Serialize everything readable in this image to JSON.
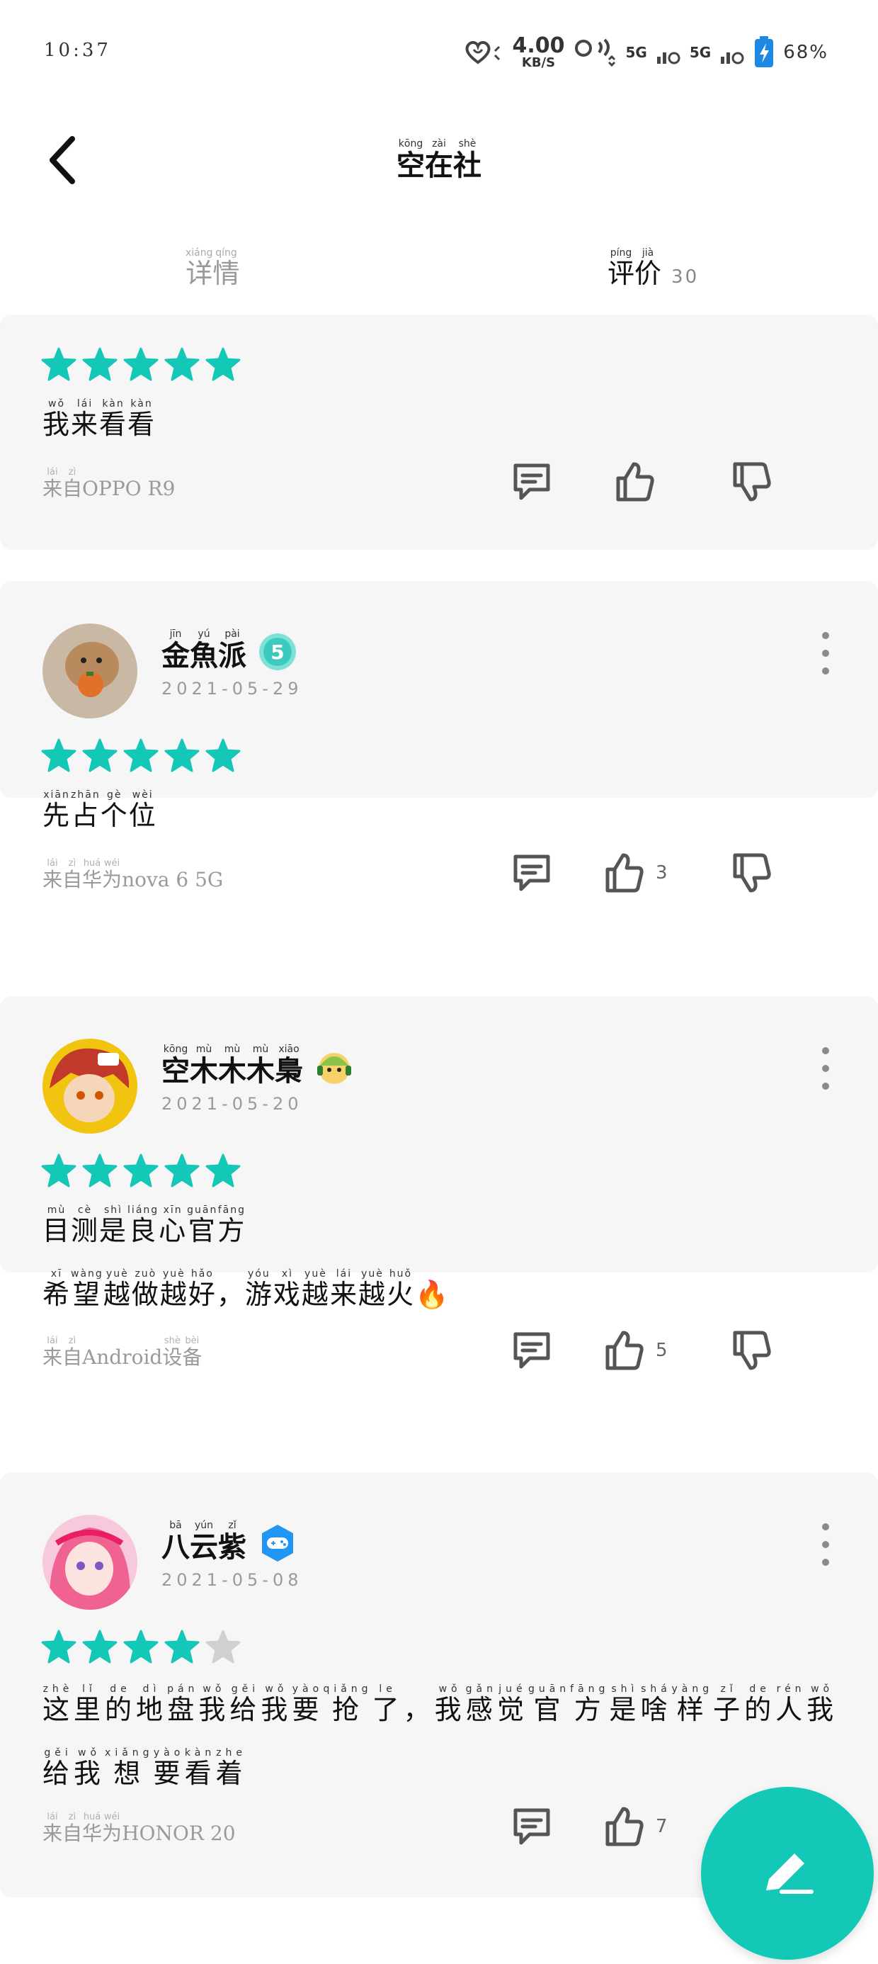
{
  "status_bar": {
    "time": "10:37",
    "speed_value": "4.00",
    "speed_unit": "KB/S",
    "sim1": "5G",
    "sim2": "5G",
    "battery": "68%"
  },
  "header": {
    "title": [
      {
        "char": "空",
        "pinyin": "kōng"
      },
      {
        "char": "在",
        "pinyin": "zài"
      },
      {
        "char": "社",
        "pinyin": "shè"
      }
    ]
  },
  "tabs": {
    "detail": [
      {
        "char": "详",
        "pinyin": "xiáng"
      },
      {
        "char": "情",
        "pinyin": "qíng"
      }
    ],
    "review": [
      {
        "char": "评",
        "pinyin": "píng"
      },
      {
        "char": "价",
        "pinyin": "jià"
      }
    ],
    "review_count": "30"
  },
  "reviews": [
    {
      "rating": 5,
      "content_lines": [
        [
          {
            "char": "我",
            "pinyin": "wǒ"
          },
          {
            "char": "来",
            "pinyin": "lái"
          },
          {
            "char": "看",
            "pinyin": "kàn"
          },
          {
            "char": "看",
            "pinyin": "kàn"
          }
        ]
      ],
      "source": [
        {
          "char": "来",
          "pinyin": "lái"
        },
        {
          "char": "自",
          "pinyin": "zì"
        },
        {
          "text": "OPPO R9"
        }
      ],
      "likes": ""
    },
    {
      "user": [
        {
          "char": "金",
          "pinyin": "jīn"
        },
        {
          "char": "魚",
          "pinyin": "yú"
        },
        {
          "char": "派",
          "pinyin": "pài"
        }
      ],
      "badge": "level-5-badge",
      "date": "2021-05-29",
      "rating": 5,
      "content_lines": [
        [
          {
            "char": "先",
            "pinyin": "xiān"
          },
          {
            "char": "占",
            "pinyin": "zhān"
          },
          {
            "char": "个",
            "pinyin": "gè"
          },
          {
            "char": "位",
            "pinyin": "wèi"
          }
        ]
      ],
      "source": [
        {
          "char": "来",
          "pinyin": "lái"
        },
        {
          "char": "自",
          "pinyin": "zì"
        },
        {
          "char": "华",
          "pinyin": "huá"
        },
        {
          "char": "为",
          "pinyin": "wéi"
        },
        {
          "text": "nova 6 5G"
        }
      ],
      "likes": "3"
    },
    {
      "user": [
        {
          "char": "空",
          "pinyin": "kōng"
        },
        {
          "char": "木",
          "pinyin": "mù"
        },
        {
          "char": "木",
          "pinyin": "mù"
        },
        {
          "char": "木",
          "pinyin": "mù"
        },
        {
          "char": "梟",
          "pinyin": "xiāo"
        }
      ],
      "badge": "gamer-avatar-badge",
      "date": "2021-05-20",
      "rating": 5,
      "content_lines": [
        [
          {
            "char": "目",
            "pinyin": "mù"
          },
          {
            "char": "测",
            "pinyin": "cè"
          },
          {
            "char": "是",
            "pinyin": "shì"
          },
          {
            "char": "良",
            "pinyin": "liáng"
          },
          {
            "char": "心",
            "pinyin": "xīn"
          },
          {
            "char": "官",
            "pinyin": "guān"
          },
          {
            "char": "方",
            "pinyin": "fāng"
          }
        ],
        [
          {
            "char": "希",
            "pinyin": "xī"
          },
          {
            "char": "望",
            "pinyin": "wàng"
          },
          {
            "char": "越",
            "pinyin": "yuè"
          },
          {
            "char": "做",
            "pinyin": "zuò"
          },
          {
            "char": "越",
            "pinyin": "yuè"
          },
          {
            "char": "好",
            "pinyin": "hǎo"
          },
          {
            "text": "，"
          },
          {
            "char": "游",
            "pinyin": "yóu"
          },
          {
            "char": "戏",
            "pinyin": "xì"
          },
          {
            "char": "越",
            "pinyin": "yuè"
          },
          {
            "char": "来",
            "pinyin": "lái"
          },
          {
            "char": "越",
            "pinyin": "yuè"
          },
          {
            "char": "火",
            "pinyin": "huǒ"
          },
          {
            "text": "🔥"
          }
        ]
      ],
      "source": [
        {
          "char": "来",
          "pinyin": "lái"
        },
        {
          "char": "自",
          "pinyin": "zì"
        },
        {
          "text": "Android"
        },
        {
          "char": "设",
          "pinyin": "shè"
        },
        {
          "char": "备",
          "pinyin": "bèi"
        }
      ],
      "likes": "5"
    },
    {
      "user": [
        {
          "char": "八",
          "pinyin": "bā"
        },
        {
          "char": "云",
          "pinyin": "yún"
        },
        {
          "char": "紫",
          "pinyin": "zǐ"
        }
      ],
      "badge": "gamepad-badge",
      "date": "2021-05-08",
      "rating": 4,
      "content_lines": [
        [
          {
            "char": "这",
            "pinyin": "zhè"
          },
          {
            "char": "里",
            "pinyin": "lǐ"
          },
          {
            "char": "的",
            "pinyin": "de"
          },
          {
            "char": "地",
            "pinyin": "dì"
          },
          {
            "char": "盘",
            "pinyin": "pán"
          },
          {
            "char": "我",
            "pinyin": "wǒ"
          },
          {
            "char": "给",
            "pinyin": "gěi"
          },
          {
            "char": "我",
            "pinyin": "wǒ"
          },
          {
            "char": "要",
            "pinyin": "yào"
          },
          {
            "char": "抢",
            "pinyin": "qiǎng"
          },
          {
            "char": "了",
            "pinyin": "le"
          },
          {
            "text": "，"
          },
          {
            "char": "我",
            "pinyin": "wǒ"
          },
          {
            "char": "感",
            "pinyin": "gǎn"
          },
          {
            "char": "觉",
            "pinyin": "jué"
          },
          {
            "char": "官",
            "pinyin": "guān"
          },
          {
            "char": "方",
            "pinyin": "fāng"
          },
          {
            "char": "是",
            "pinyin": "shì"
          },
          {
            "char": "啥",
            "pinyin": "shá"
          },
          {
            "char": "样",
            "pinyin": "yàng"
          },
          {
            "char": "子",
            "pinyin": "zǐ"
          },
          {
            "char": "的",
            "pinyin": "de"
          },
          {
            "char": "人",
            "pinyin": "rén"
          },
          {
            "char": "我",
            "pinyin": "wǒ"
          }
        ],
        [
          {
            "char": "给",
            "pinyin": "gěi"
          },
          {
            "char": "我",
            "pinyin": "wǒ"
          },
          {
            "char": "想",
            "pinyin": "xiǎng"
          },
          {
            "char": "要",
            "pinyin": "yào"
          },
          {
            "char": "看",
            "pinyin": "kàn"
          },
          {
            "char": "着",
            "pinyin": "zhe"
          }
        ]
      ],
      "source": [
        {
          "char": "来",
          "pinyin": "lái"
        },
        {
          "char": "自",
          "pinyin": "zì"
        },
        {
          "char": "华",
          "pinyin": "huá"
        },
        {
          "char": "为",
          "pinyin": "wéi"
        },
        {
          "text": "HONOR 20"
        }
      ],
      "likes": "7"
    }
  ],
  "fab": {
    "icon": "write-icon"
  },
  "colors": {
    "accent": "#14c8b8",
    "star_empty": "#d0d0d0",
    "card_bg": "#f6f6f6"
  }
}
